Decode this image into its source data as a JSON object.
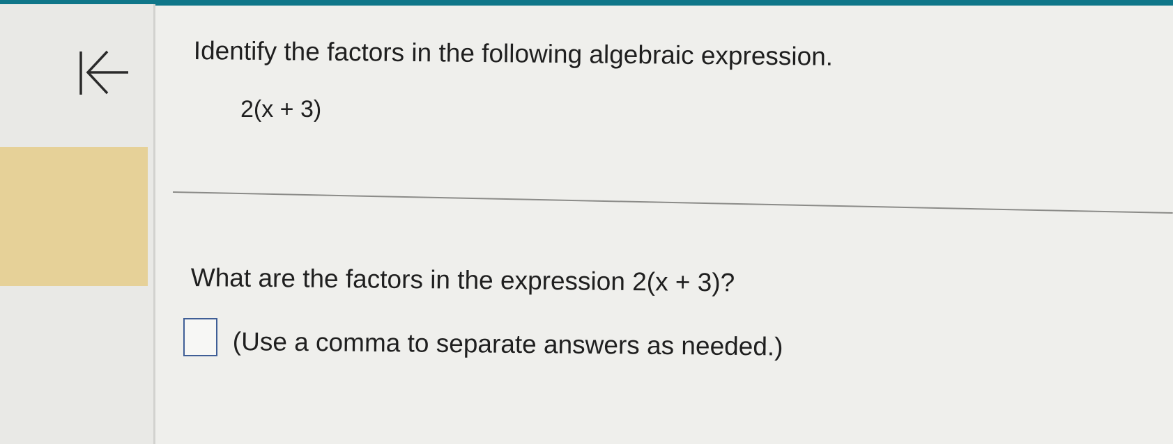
{
  "question": {
    "title": "Identify the factors in the following algebraic expression.",
    "expression": "2(x + 3)",
    "prompt": "What are the factors in the expression 2(x + 3)?",
    "hint": "(Use a comma to separate answers as needed.)"
  },
  "answer": {
    "value": ""
  },
  "colors": {
    "top_bar": "#0f7689",
    "highlight": "#e6d198",
    "answer_border": "#3f5e96"
  },
  "icons": {
    "back": "arrow-left-to-line-icon"
  }
}
